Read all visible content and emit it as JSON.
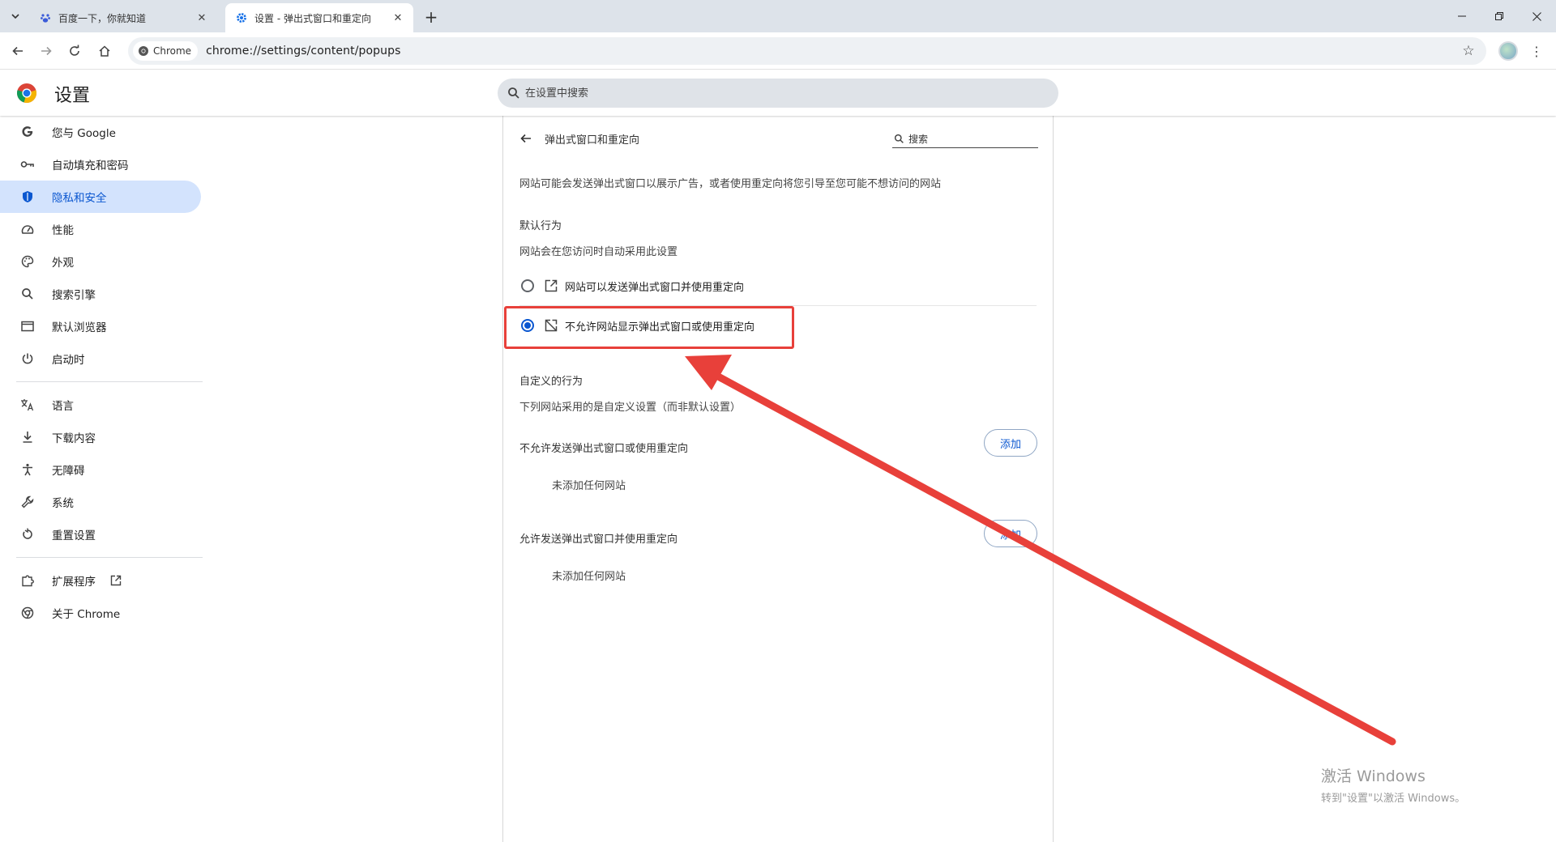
{
  "browser": {
    "tabs": [
      {
        "title": "百度一下，你就知道",
        "active": false
      },
      {
        "title": "设置 - 弹出式窗口和重定向",
        "active": true
      }
    ],
    "chip_label": "Chrome",
    "url": "chrome://settings/content/popups"
  },
  "settings": {
    "title": "设置",
    "search_placeholder": "在设置中搜索"
  },
  "sidebar": {
    "items": [
      {
        "label": "您与 Google",
        "icon": "google-g-icon",
        "active": false
      },
      {
        "label": "自动填充和密码",
        "icon": "key-icon",
        "active": false
      },
      {
        "label": "隐私和安全",
        "icon": "shield-icon",
        "active": true
      },
      {
        "label": "性能",
        "icon": "speedometer-icon",
        "active": false
      },
      {
        "label": "外观",
        "icon": "palette-icon",
        "active": false
      },
      {
        "label": "搜索引擎",
        "icon": "search-icon",
        "active": false
      },
      {
        "label": "默认浏览器",
        "icon": "browser-window-icon",
        "active": false
      },
      {
        "label": "启动时",
        "icon": "power-icon",
        "active": false
      },
      {
        "label": "语言",
        "icon": "translate-icon",
        "active": false
      },
      {
        "label": "下载内容",
        "icon": "download-icon",
        "active": false
      },
      {
        "label": "无障碍",
        "icon": "accessibility-icon",
        "active": false
      },
      {
        "label": "系统",
        "icon": "wrench-icon",
        "active": false
      },
      {
        "label": "重置设置",
        "icon": "reset-icon",
        "active": false
      },
      {
        "label": "扩展程序",
        "icon": "puzzle-icon",
        "active": false
      },
      {
        "label": "关于 Chrome",
        "icon": "chrome-icon",
        "active": false
      }
    ]
  },
  "content": {
    "subpage_title": "弹出式窗口和重定向",
    "search_placeholder": "搜索",
    "description": "网站可能会发送弹出式窗口以展示广告，或者使用重定向将您引导至您可能不想访问的网站",
    "default_behavior_heading": "默认行为",
    "default_behavior_sub": "网站会在您访问时自动采用此设置",
    "options": [
      {
        "label": "网站可以发送弹出式窗口并使用重定向",
        "checked": false,
        "icon": "open-in-new-icon"
      },
      {
        "label": "不允许网站显示弹出式窗口或使用重定向",
        "checked": true,
        "icon": "popup-blocked-icon"
      }
    ],
    "custom_behavior_heading": "自定义的行为",
    "custom_behavior_sub": "下列网站采用的是自定义设置（而非默认设置）",
    "block_list_heading": "不允许发送弹出式窗口或使用重定向",
    "allow_list_heading": "允许发送弹出式窗口并使用重定向",
    "add_label": "添加",
    "empty_label": "未添加任何网站"
  },
  "watermark": {
    "line1": "激活 Windows",
    "line2": "转到\"设置\"以激活 Windows。"
  },
  "colors": {
    "accent": "#0b57d0",
    "active_nav_bg": "#d3e3fd",
    "annotation": "#e8403a"
  }
}
